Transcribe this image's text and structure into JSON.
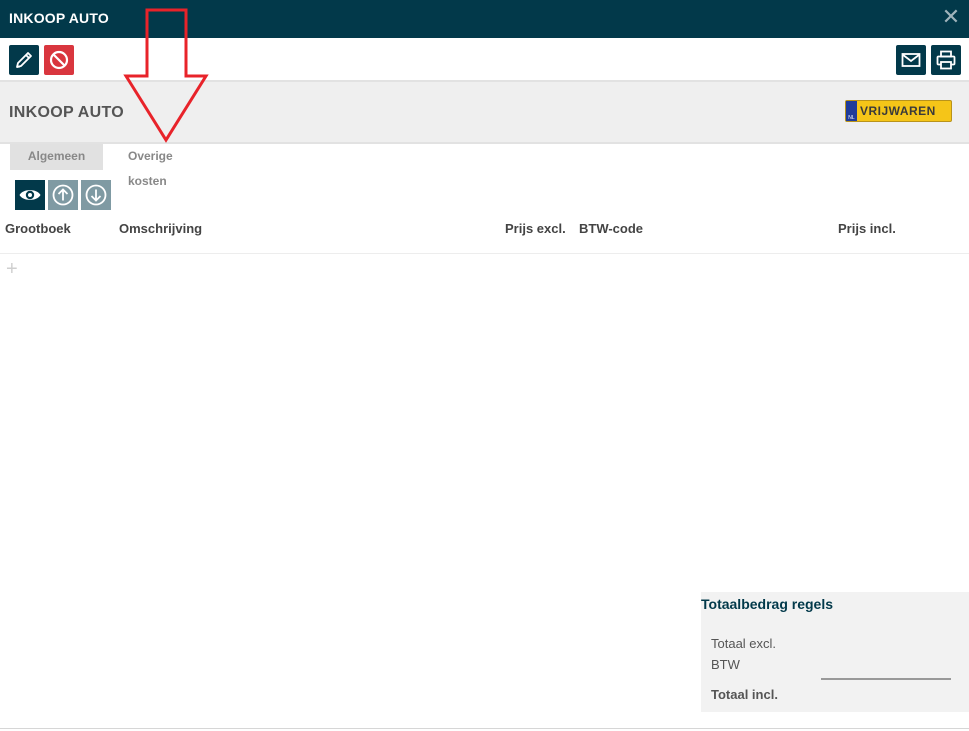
{
  "window": {
    "title": "INKOOP AUTO",
    "close_symbol": "✕"
  },
  "toolbar": {
    "left": [
      {
        "name": "edit",
        "icon": "pencil-icon"
      },
      {
        "name": "cancel",
        "icon": "ban-icon"
      }
    ],
    "right": [
      {
        "name": "email",
        "icon": "envelope-icon"
      },
      {
        "name": "print",
        "icon": "printer-icon"
      }
    ]
  },
  "header": {
    "title": "INKOOP AUTO",
    "badge": {
      "country": "NL",
      "label": "VRIJWAREN",
      "color": "#f5c518"
    }
  },
  "tabs": [
    {
      "label": "Algemeen",
      "active": true
    },
    {
      "label": "Overige kosten",
      "active": false
    }
  ],
  "row_actions": [
    {
      "name": "view",
      "icon": "eye-icon"
    },
    {
      "name": "move-up",
      "icon": "arrow-up-circle-icon"
    },
    {
      "name": "move-down",
      "icon": "arrow-down-circle-icon"
    }
  ],
  "table": {
    "columns": [
      "Grootboek",
      "Omschrijving",
      "Prijs excl.",
      "BTW-code",
      "Prijs incl."
    ],
    "rows": [],
    "add_symbol": "+"
  },
  "totals": {
    "title": "Totaalbedrag regels",
    "excl_label": "Totaal excl.",
    "btw_label": "BTW",
    "incl_label": "Totaal incl."
  },
  "colors": {
    "titlebar": "#02394a",
    "accent": "#02394a",
    "danger": "#d9363e",
    "annotation_arrow": "#e8232a"
  }
}
